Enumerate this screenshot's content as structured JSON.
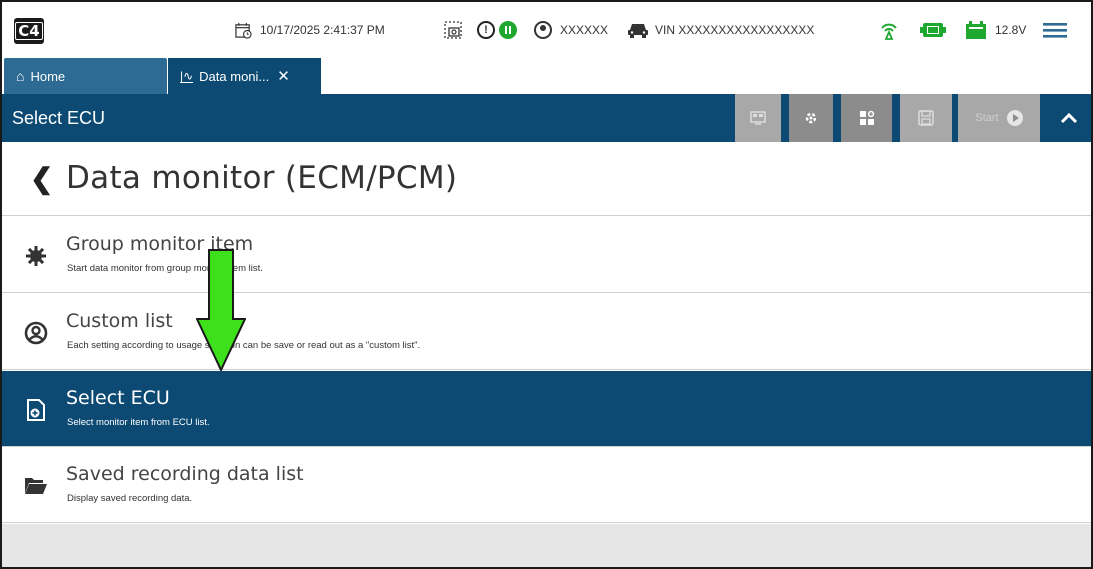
{
  "statusbar": {
    "logo_text": "C4",
    "datetime": "10/17/2025 2:41:37 PM",
    "user": "XXXXXX",
    "vin": "VIN XXXXXXXXXXXXXXXXX",
    "voltage": "12.8V",
    "icons": [
      "calendar-clock-icon",
      "screenshot-icon",
      "alert-icon",
      "pause-icon",
      "user-icon",
      "car-icon",
      "signal-icon",
      "vci-battery-icon",
      "battery-icon",
      "menu-icon"
    ]
  },
  "tabs": [
    {
      "label": "Home",
      "icon": "home-icon"
    },
    {
      "label": "Data moni...",
      "icon": "chart-icon"
    }
  ],
  "header": {
    "title": "Select ECU",
    "start_label": "Start"
  },
  "page": {
    "title": "Data monitor (ECM/PCM)"
  },
  "menu": [
    {
      "title": "Group monitor item",
      "desc": "Start data monitor from group monitor item list.",
      "icon": "gear-icon"
    },
    {
      "title": "Custom list",
      "desc": "Each setting according to usage situation can be save or read out as a \"custom list\".",
      "icon": "user-icon"
    },
    {
      "title": "Select ECU",
      "desc": "Select monitor item from ECU list.",
      "icon": "add-file-icon"
    },
    {
      "title": "Saved recording data list",
      "desc": "Display saved recording data.",
      "icon": "folder-icon"
    }
  ],
  "colors": {
    "primary": "#0c4a74",
    "tab_home": "#2e6b94",
    "status_green": "#1fa830",
    "arrow_green": "#3ee01c"
  }
}
